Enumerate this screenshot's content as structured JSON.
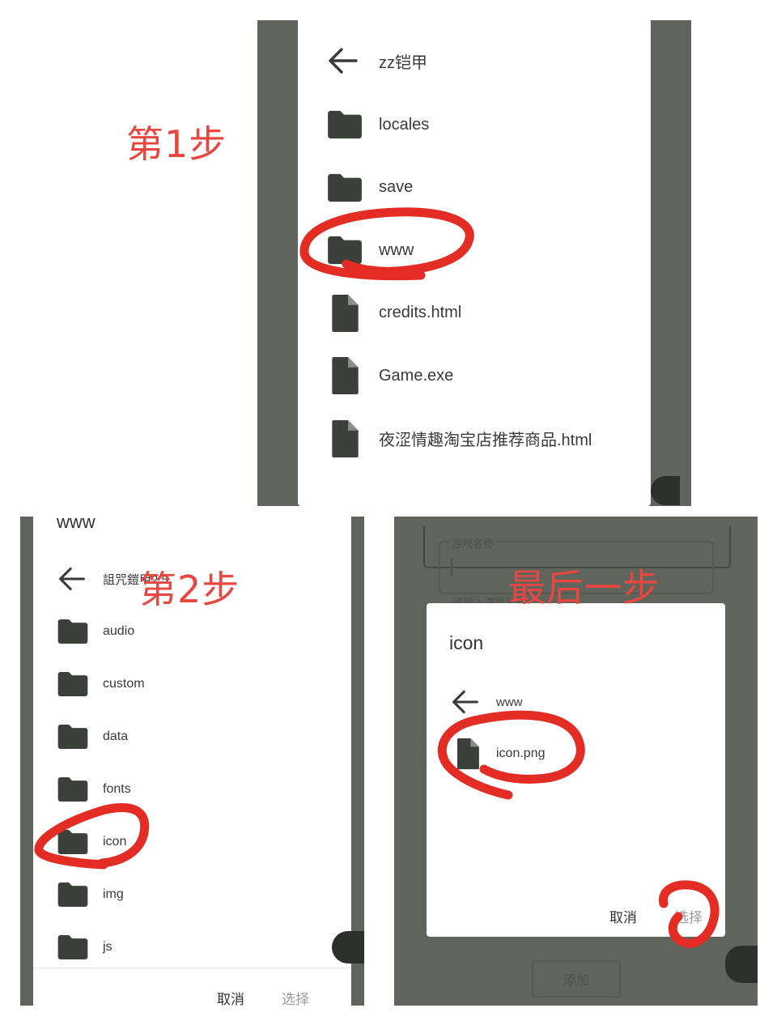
{
  "steps": {
    "step1": "第1步",
    "step2": "第2步",
    "step3": "最后一步"
  },
  "dialog1": {
    "back_icon": "arrow-left-icon",
    "folder": "zz铠甲",
    "items": [
      {
        "type": "folder",
        "icon": "folder-icon",
        "name": "locales"
      },
      {
        "type": "folder",
        "icon": "folder-icon",
        "name": "save"
      },
      {
        "type": "folder",
        "icon": "folder-icon",
        "name": "www"
      },
      {
        "type": "file",
        "icon": "file-icon",
        "name": "credits.html"
      },
      {
        "type": "file",
        "icon": "file-icon",
        "name": "Game.exe"
      },
      {
        "type": "file",
        "icon": "file-icon",
        "name": "夜涩情趣淘宝店推荐商品.html"
      }
    ]
  },
  "dialog2": {
    "title": "www",
    "back_icon": "arrow-left-icon",
    "folder": "詛咒鎧甲2.5",
    "items": [
      {
        "type": "folder",
        "icon": "folder-icon",
        "name": "audio"
      },
      {
        "type": "folder",
        "icon": "folder-icon",
        "name": "custom"
      },
      {
        "type": "folder",
        "icon": "folder-icon",
        "name": "data"
      },
      {
        "type": "folder",
        "icon": "folder-icon",
        "name": "fonts"
      },
      {
        "type": "folder",
        "icon": "folder-icon",
        "name": "icon"
      },
      {
        "type": "folder",
        "icon": "folder-icon",
        "name": "img"
      },
      {
        "type": "folder",
        "icon": "folder-icon",
        "name": "js"
      }
    ],
    "cancel": "取消",
    "select": "选择"
  },
  "dialog3": {
    "bg_field_label": "游戏名称",
    "bg_hint": "请输入游戏名称",
    "bg_add_button": "添加",
    "title": "icon",
    "back_icon": "arrow-left-icon",
    "folder": "www",
    "items": [
      {
        "type": "file",
        "icon": "file-icon",
        "name": "icon.png"
      }
    ],
    "cancel": "取消",
    "select": "选择"
  },
  "colors": {
    "annotation_red": "#e8473f",
    "scrim_gray": "#5f655d",
    "icon_dark": "#3c403b",
    "text": "#3a3a3a"
  }
}
